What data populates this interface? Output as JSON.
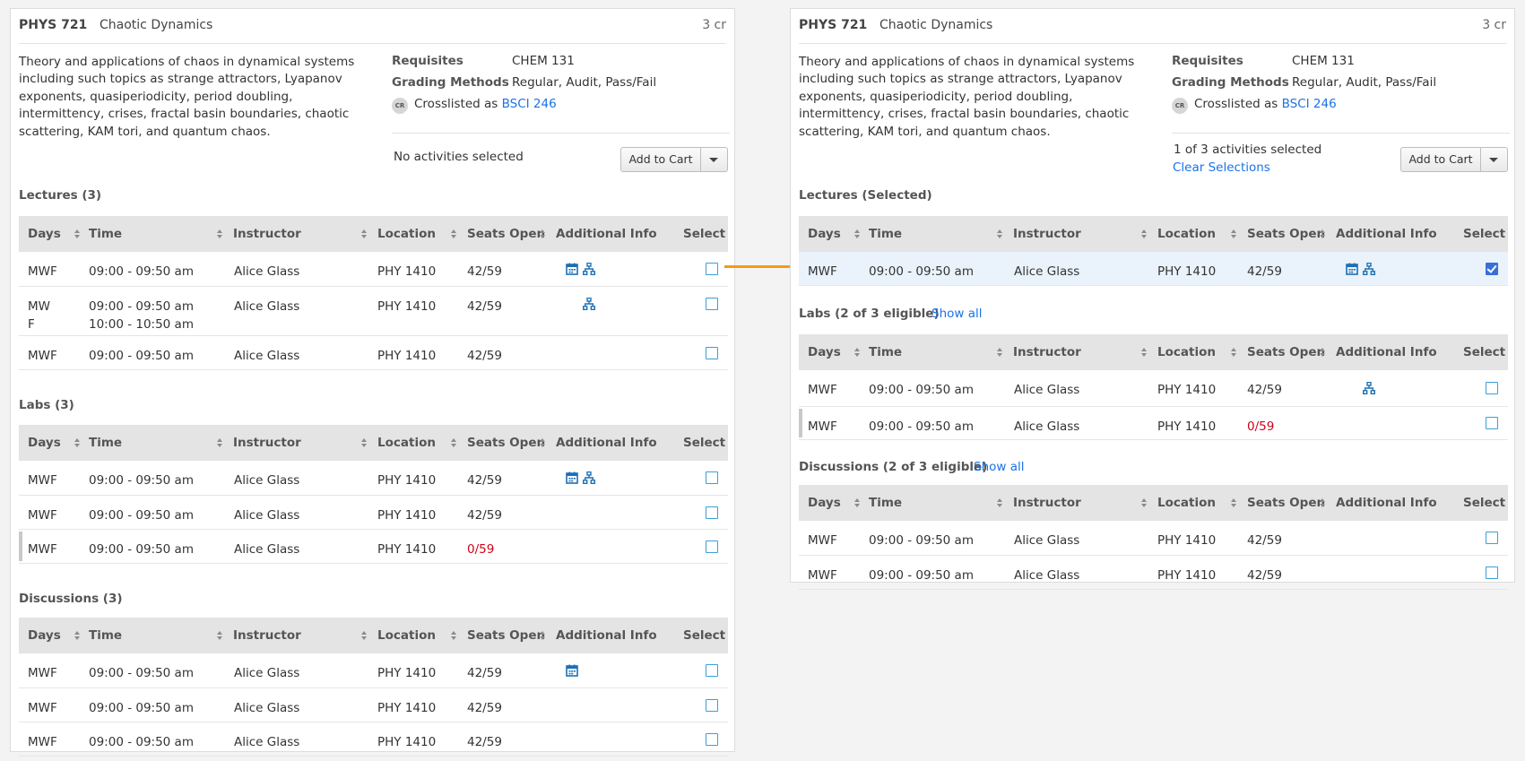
{
  "course": {
    "code": "PHYS 721",
    "title": "Chaotic Dynamics",
    "credits": "3 cr",
    "description": "Theory and applications of chaos in dynamical systems including such topics as strange attractors, Lyapanov exponents, quasiperiodicity, period doubling, intermittency, crises, fractal basin boundaries, chaotic scattering, KAM tori, and quantum chaos.",
    "requisites_label": "Requisites",
    "requisites": "CHEM 131",
    "grading_label": "Grading Methods",
    "grading": "Regular, Audit, Pass/Fail",
    "cr_badge": "CR",
    "crosslisted_prefix": "Crosslisted as",
    "crosslisted_course": "BSCI 246",
    "add_to_cart": "Add to Cart"
  },
  "columns": [
    "Days",
    "Time",
    "Instructor",
    "Location",
    "Seats Open",
    "Additional Info",
    "Select"
  ],
  "colors": {
    "accent": "#1a73e8",
    "arrow": "#f39c12",
    "full": "#d0021b",
    "icon": "#1e6fb5"
  },
  "icons": [
    "calendar-icon",
    "hierarchy-icon"
  ],
  "left": {
    "status": "No activities selected",
    "lectures_title": "Lectures (3)",
    "lectures": [
      {
        "days": "MWF",
        "time": "09:00 - 09:50 am",
        "instructor": "Alice Glass",
        "location": "PHY 1410",
        "seats": "42/59"
      },
      {
        "days": "MW",
        "days2": "F",
        "time": "09:00 - 09:50 am",
        "time2": "10:00 - 10:50 am",
        "instructor": "Alice Glass",
        "location": "PHY 1410",
        "seats": "42/59"
      },
      {
        "days": "MWF",
        "time": "09:00 - 09:50 am",
        "instructor": "Alice Glass",
        "location": "PHY 1410",
        "seats": "42/59"
      }
    ],
    "labs_title": "Labs (3)",
    "labs": [
      {
        "days": "MWF",
        "time": "09:00 - 09:50 am",
        "instructor": "Alice Glass",
        "location": "PHY 1410",
        "seats": "42/59"
      },
      {
        "days": "MWF",
        "time": "09:00 - 09:50 am",
        "instructor": "Alice Glass",
        "location": "PHY 1410",
        "seats": "42/59"
      },
      {
        "days": "MWF",
        "time": "09:00 - 09:50 am",
        "instructor": "Alice Glass",
        "location": "PHY 1410",
        "seats": "0/59"
      }
    ],
    "discussions_title": "Discussions (3)",
    "discussions": [
      {
        "days": "MWF",
        "time": "09:00 - 09:50 am",
        "instructor": "Alice Glass",
        "location": "PHY 1410",
        "seats": "42/59"
      },
      {
        "days": "MWF",
        "time": "09:00 - 09:50 am",
        "instructor": "Alice Glass",
        "location": "PHY 1410",
        "seats": "42/59"
      },
      {
        "days": "MWF",
        "time": "09:00 - 09:50 am",
        "instructor": "Alice Glass",
        "location": "PHY 1410",
        "seats": "42/59"
      }
    ]
  },
  "right": {
    "status": "1 of 3 activities selected",
    "clear": "Clear Selections",
    "lectures_title": "Lectures (Selected)",
    "lectures": [
      {
        "days": "MWF",
        "time": "09:00 - 09:50 am",
        "instructor": "Alice Glass",
        "location": "PHY 1410",
        "seats": "42/59"
      }
    ],
    "labs_title": "Labs (2 of 3 eligible)",
    "show_all": "Show all",
    "labs": [
      {
        "days": "MWF",
        "time": "09:00 - 09:50 am",
        "instructor": "Alice Glass",
        "location": "PHY 1410",
        "seats": "42/59"
      },
      {
        "days": "MWF",
        "time": "09:00 - 09:50 am",
        "instructor": "Alice Glass",
        "location": "PHY 1410",
        "seats": "0/59"
      }
    ],
    "discussions_title": "Discussions (2 of 3 eligible)",
    "discussions": [
      {
        "days": "MWF",
        "time": "09:00 - 09:50 am",
        "instructor": "Alice Glass",
        "location": "PHY 1410",
        "seats": "42/59"
      },
      {
        "days": "MWF",
        "time": "09:00 - 09:50 am",
        "instructor": "Alice Glass",
        "location": "PHY 1410",
        "seats": "42/59"
      }
    ]
  }
}
